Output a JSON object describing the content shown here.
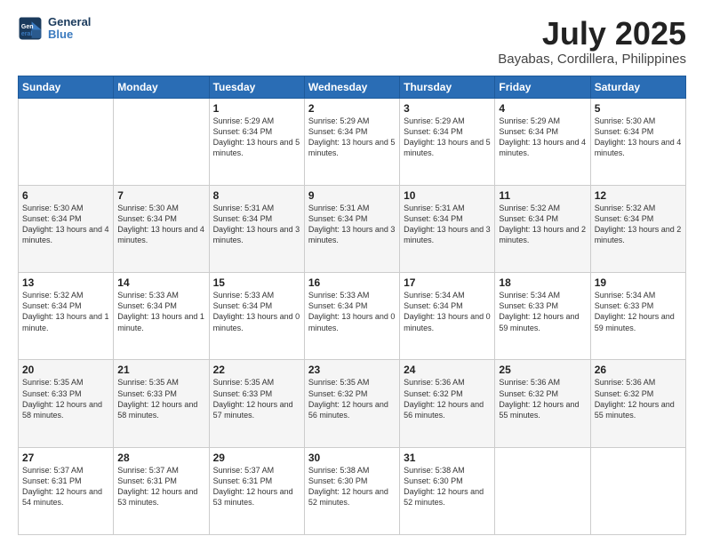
{
  "header": {
    "logo_line1": "General",
    "logo_line2": "Blue",
    "title": "July 2025",
    "subtitle": "Bayabas, Cordillera, Philippines"
  },
  "weekdays": [
    "Sunday",
    "Monday",
    "Tuesday",
    "Wednesday",
    "Thursday",
    "Friday",
    "Saturday"
  ],
  "weeks": [
    [
      {
        "day": "",
        "info": ""
      },
      {
        "day": "",
        "info": ""
      },
      {
        "day": "1",
        "info": "Sunrise: 5:29 AM\nSunset: 6:34 PM\nDaylight: 13 hours\nand 5 minutes."
      },
      {
        "day": "2",
        "info": "Sunrise: 5:29 AM\nSunset: 6:34 PM\nDaylight: 13 hours\nand 5 minutes."
      },
      {
        "day": "3",
        "info": "Sunrise: 5:29 AM\nSunset: 6:34 PM\nDaylight: 13 hours\nand 5 minutes."
      },
      {
        "day": "4",
        "info": "Sunrise: 5:29 AM\nSunset: 6:34 PM\nDaylight: 13 hours\nand 4 minutes."
      },
      {
        "day": "5",
        "info": "Sunrise: 5:30 AM\nSunset: 6:34 PM\nDaylight: 13 hours\nand 4 minutes."
      }
    ],
    [
      {
        "day": "6",
        "info": "Sunrise: 5:30 AM\nSunset: 6:34 PM\nDaylight: 13 hours\nand 4 minutes."
      },
      {
        "day": "7",
        "info": "Sunrise: 5:30 AM\nSunset: 6:34 PM\nDaylight: 13 hours\nand 4 minutes."
      },
      {
        "day": "8",
        "info": "Sunrise: 5:31 AM\nSunset: 6:34 PM\nDaylight: 13 hours\nand 3 minutes."
      },
      {
        "day": "9",
        "info": "Sunrise: 5:31 AM\nSunset: 6:34 PM\nDaylight: 13 hours\nand 3 minutes."
      },
      {
        "day": "10",
        "info": "Sunrise: 5:31 AM\nSunset: 6:34 PM\nDaylight: 13 hours\nand 3 minutes."
      },
      {
        "day": "11",
        "info": "Sunrise: 5:32 AM\nSunset: 6:34 PM\nDaylight: 13 hours\nand 2 minutes."
      },
      {
        "day": "12",
        "info": "Sunrise: 5:32 AM\nSunset: 6:34 PM\nDaylight: 13 hours\nand 2 minutes."
      }
    ],
    [
      {
        "day": "13",
        "info": "Sunrise: 5:32 AM\nSunset: 6:34 PM\nDaylight: 13 hours\nand 1 minute."
      },
      {
        "day": "14",
        "info": "Sunrise: 5:33 AM\nSunset: 6:34 PM\nDaylight: 13 hours\nand 1 minute."
      },
      {
        "day": "15",
        "info": "Sunrise: 5:33 AM\nSunset: 6:34 PM\nDaylight: 13 hours\nand 0 minutes."
      },
      {
        "day": "16",
        "info": "Sunrise: 5:33 AM\nSunset: 6:34 PM\nDaylight: 13 hours\nand 0 minutes."
      },
      {
        "day": "17",
        "info": "Sunrise: 5:34 AM\nSunset: 6:34 PM\nDaylight: 13 hours\nand 0 minutes."
      },
      {
        "day": "18",
        "info": "Sunrise: 5:34 AM\nSunset: 6:33 PM\nDaylight: 12 hours\nand 59 minutes."
      },
      {
        "day": "19",
        "info": "Sunrise: 5:34 AM\nSunset: 6:33 PM\nDaylight: 12 hours\nand 59 minutes."
      }
    ],
    [
      {
        "day": "20",
        "info": "Sunrise: 5:35 AM\nSunset: 6:33 PM\nDaylight: 12 hours\nand 58 minutes."
      },
      {
        "day": "21",
        "info": "Sunrise: 5:35 AM\nSunset: 6:33 PM\nDaylight: 12 hours\nand 58 minutes."
      },
      {
        "day": "22",
        "info": "Sunrise: 5:35 AM\nSunset: 6:33 PM\nDaylight: 12 hours\nand 57 minutes."
      },
      {
        "day": "23",
        "info": "Sunrise: 5:35 AM\nSunset: 6:32 PM\nDaylight: 12 hours\nand 56 minutes."
      },
      {
        "day": "24",
        "info": "Sunrise: 5:36 AM\nSunset: 6:32 PM\nDaylight: 12 hours\nand 56 minutes."
      },
      {
        "day": "25",
        "info": "Sunrise: 5:36 AM\nSunset: 6:32 PM\nDaylight: 12 hours\nand 55 minutes."
      },
      {
        "day": "26",
        "info": "Sunrise: 5:36 AM\nSunset: 6:32 PM\nDaylight: 12 hours\nand 55 minutes."
      }
    ],
    [
      {
        "day": "27",
        "info": "Sunrise: 5:37 AM\nSunset: 6:31 PM\nDaylight: 12 hours\nand 54 minutes."
      },
      {
        "day": "28",
        "info": "Sunrise: 5:37 AM\nSunset: 6:31 PM\nDaylight: 12 hours\nand 53 minutes."
      },
      {
        "day": "29",
        "info": "Sunrise: 5:37 AM\nSunset: 6:31 PM\nDaylight: 12 hours\nand 53 minutes."
      },
      {
        "day": "30",
        "info": "Sunrise: 5:38 AM\nSunset: 6:30 PM\nDaylight: 12 hours\nand 52 minutes."
      },
      {
        "day": "31",
        "info": "Sunrise: 5:38 AM\nSunset: 6:30 PM\nDaylight: 12 hours\nand 52 minutes."
      },
      {
        "day": "",
        "info": ""
      },
      {
        "day": "",
        "info": ""
      }
    ]
  ]
}
